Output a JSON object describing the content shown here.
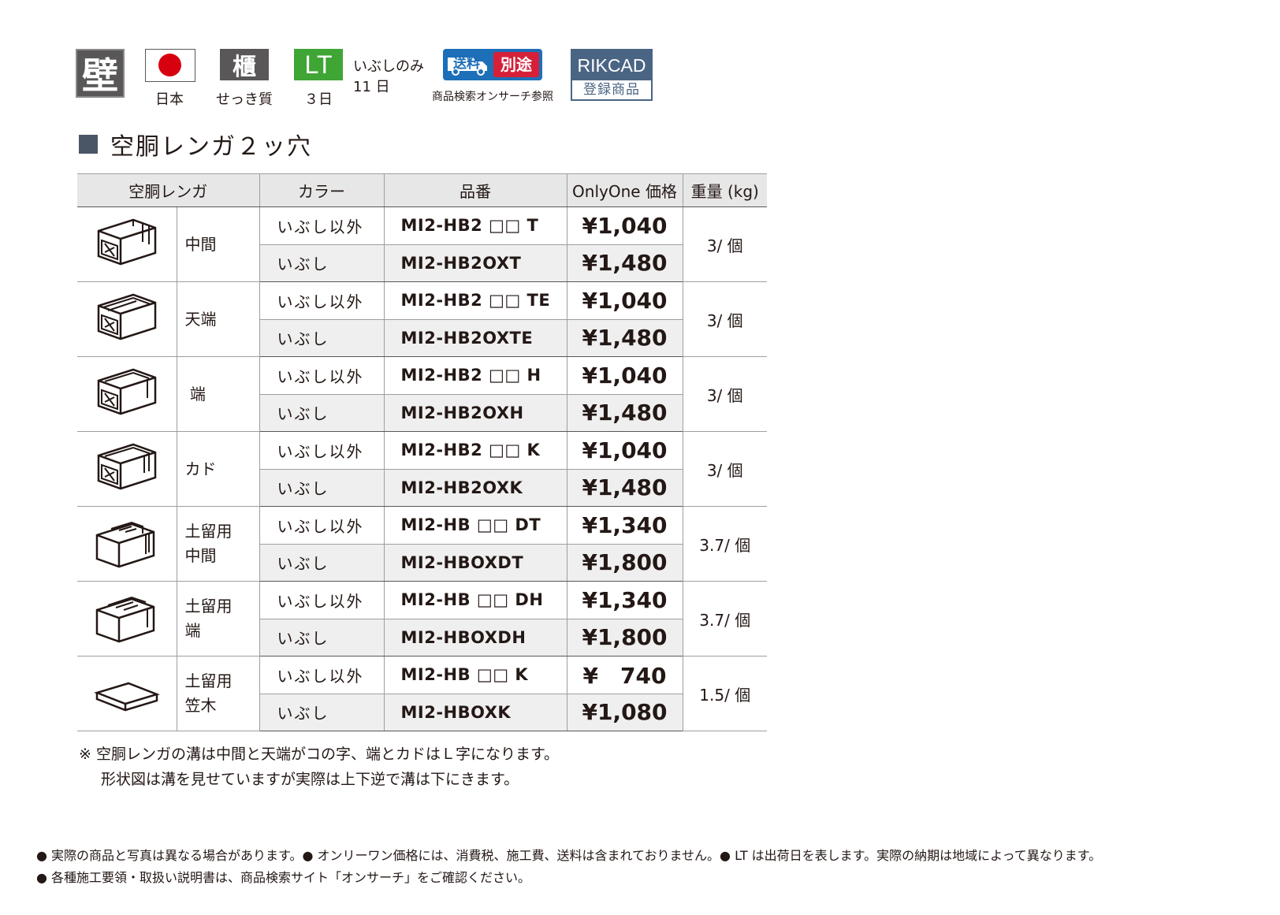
{
  "badges": {
    "wall_glyph": "壁",
    "origin_label": "日本",
    "material_glyph": "櫃",
    "material_label": "せっき質",
    "lt_glyph": "LT",
    "lt_label": "３日",
    "lt_note_line1": "いぶしのみ",
    "lt_note_line2": "11 日",
    "shipping_left": "送料",
    "shipping_right": "別途",
    "shipping_label": "商品検索オンサーチ参照",
    "rikcad_top": "RIKCAD",
    "rikcad_bottom": "登録商品"
  },
  "section_title": "空胴レンガ２ッ穴",
  "table": {
    "headers": [
      "空胴レンガ",
      "カラー",
      "品番",
      "OnlyOne 価格",
      "重量 (kg)"
    ],
    "groups": [
      {
        "icon": "hollow-brick-middle-icon",
        "type_line1": "中間",
        "type_line2": "",
        "weight": "3/ 個",
        "rows": [
          {
            "color": "いぶし以外",
            "code": "MI2-HB2 □□ T",
            "price": "¥1,040"
          },
          {
            "color": "いぶし",
            "code": "MI2-HB2OXT",
            "price": "¥1,480"
          }
        ]
      },
      {
        "icon": "hollow-brick-top-icon",
        "type_line1": "天端",
        "type_line2": "",
        "weight": "3/ 個",
        "rows": [
          {
            "color": "いぶし以外",
            "code": "MI2-HB2 □□ TE",
            "price": "¥1,040"
          },
          {
            "color": "いぶし",
            "code": "MI2-HB2OXTE",
            "price": "¥1,480"
          }
        ]
      },
      {
        "icon": "hollow-brick-end-icon",
        "type_line1": " 端",
        "type_line2": "",
        "weight": "3/ 個",
        "rows": [
          {
            "color": "いぶし以外",
            "code": "MI2-HB2 □□ H",
            "price": "¥1,040"
          },
          {
            "color": "いぶし",
            "code": "MI2-HB2OXH",
            "price": "¥1,480"
          }
        ]
      },
      {
        "icon": "hollow-brick-corner-icon",
        "type_line1": "カド",
        "type_line2": "",
        "weight": "3/ 個",
        "rows": [
          {
            "color": "いぶし以外",
            "code": "MI2-HB2 □□ K",
            "price": "¥1,040"
          },
          {
            "color": "いぶし",
            "code": "MI2-HB2OXK",
            "price": "¥1,480"
          }
        ]
      },
      {
        "icon": "retaining-brick-middle-icon",
        "type_line1": "土留用",
        "type_line2": "中間",
        "weight": "3.7/ 個",
        "rows": [
          {
            "color": "いぶし以外",
            "code": "MI2-HB □□ DT",
            "price": "¥1,340"
          },
          {
            "color": "いぶし",
            "code": "MI2-HBOXDT",
            "price": "¥1,800"
          }
        ]
      },
      {
        "icon": "retaining-brick-end-icon",
        "type_line1": "土留用",
        "type_line2": "端",
        "weight": "3.7/ 個",
        "rows": [
          {
            "color": "いぶし以外",
            "code": "MI2-HB □□ DH",
            "price": "¥1,340"
          },
          {
            "color": "いぶし",
            "code": "MI2-HBOXDH",
            "price": "¥1,800"
          }
        ]
      },
      {
        "icon": "coping-slab-icon",
        "type_line1": "土留用",
        "type_line2": "笠木",
        "weight": "1.5/ 個",
        "rows": [
          {
            "color": "いぶし以外",
            "code": "MI2-HB □□ K",
            "price": "¥　740"
          },
          {
            "color": "いぶし",
            "code": "MI2-HBOXK",
            "price": "¥1,080"
          }
        ]
      }
    ]
  },
  "notes": {
    "line1": "※ 空胴レンガの溝は中間と天端がコの字、端とカドはＬ字になります。",
    "line2": "形状図は溝を見せていますが実際は上下逆で溝は下にきます。"
  },
  "footer": {
    "line1": "● 実際の商品と写真は異なる場合があります。● オンリーワン価格には、消費税、施工費、送料は含まれておりません。● LT は出荷日を表します。実際の納期は地域によって異なります。",
    "line2": "● 各種施工要領・取扱い説明書は、商品検索サイト「オンサーチ」をご確認ください。"
  },
  "colors": {
    "badge_gray": "#595757",
    "lt_green": "#3fa535",
    "shipping_blue": "#1d6fb8",
    "shipping_red": "#d6203a",
    "rikcad_blue": "#4a6584",
    "flag_red": "#d7000f",
    "header_bg": "#e7e7e7",
    "row_shade": "#efefef"
  }
}
